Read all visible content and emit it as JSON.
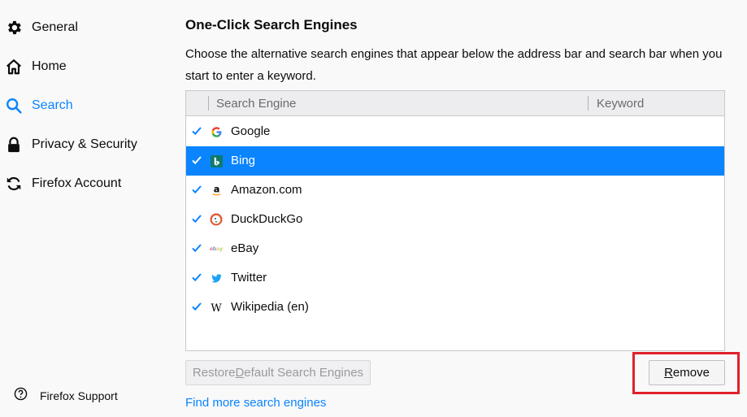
{
  "sidebar": {
    "items": [
      {
        "label": "General",
        "icon": "gear-icon"
      },
      {
        "label": "Home",
        "icon": "home-icon"
      },
      {
        "label": "Search",
        "icon": "search-icon",
        "selected": true
      },
      {
        "label": "Privacy & Security",
        "icon": "lock-icon"
      },
      {
        "label": "Firefox Account",
        "icon": "sync-icon"
      }
    ],
    "support_label": "Firefox Support"
  },
  "main": {
    "heading": "One-Click Search Engines",
    "description": "Choose the alternative search engines that appear below the address bar and search bar when you start to enter a keyword.",
    "columns": {
      "engine": "Search Engine",
      "keyword": "Keyword"
    },
    "engines": [
      {
        "name": "Google",
        "checked": true,
        "icon": "google-icon"
      },
      {
        "name": "Bing",
        "checked": true,
        "icon": "bing-icon",
        "selected": true
      },
      {
        "name": "Amazon.com",
        "checked": true,
        "icon": "amazon-icon"
      },
      {
        "name": "DuckDuckGo",
        "checked": true,
        "icon": "duckduckgo-icon"
      },
      {
        "name": "eBay",
        "checked": true,
        "icon": "ebay-icon"
      },
      {
        "name": "Twitter",
        "checked": true,
        "icon": "twitter-icon"
      },
      {
        "name": "Wikipedia (en)",
        "checked": true,
        "icon": "wikipedia-icon"
      }
    ],
    "restore_button": {
      "pre": "Restore ",
      "accesskey": "D",
      "post": "efault Search Engines"
    },
    "remove_button": {
      "accesskey": "R",
      "post": "emove"
    },
    "find_more_link": "Find more search engines"
  },
  "colors": {
    "accent": "#0a84ff",
    "highlight": "#e0212b"
  }
}
